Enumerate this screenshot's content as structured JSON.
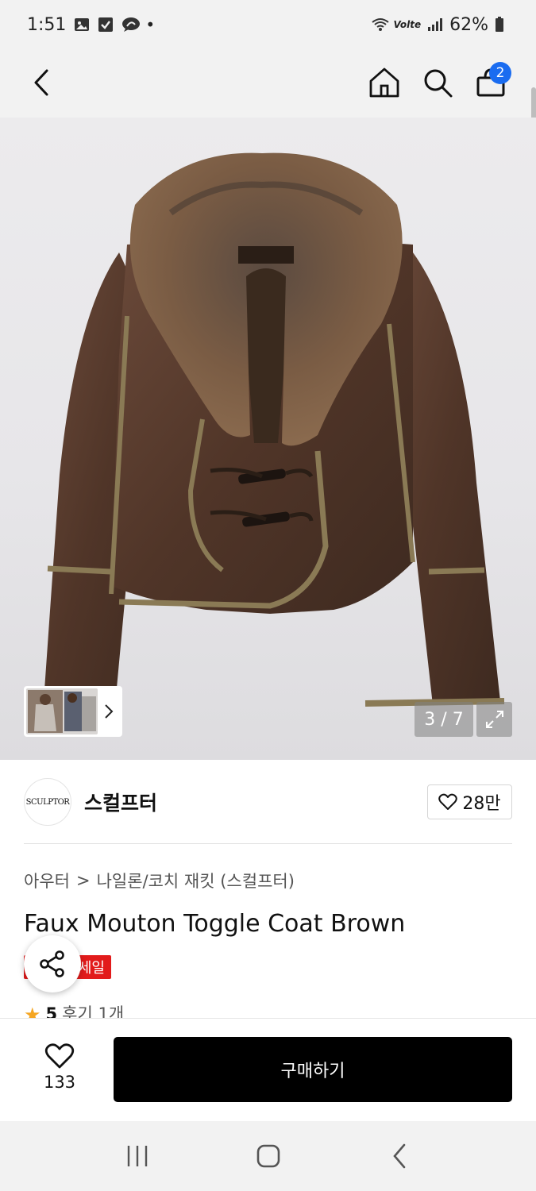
{
  "status_bar": {
    "time": "1:51",
    "battery": "62%",
    "network": "Volte"
  },
  "nav": {
    "cart_count": "2"
  },
  "gallery": {
    "counter": "3 / 7"
  },
  "brand": {
    "logo_text": "SCULPTOR",
    "name": "스컬프터",
    "likes": "28만"
  },
  "breadcrumb": {
    "category": "아우터",
    "separator": ">",
    "subcategory": "나일론/코치 재킷 (스컬프터)"
  },
  "product": {
    "title": "Faux Mouton Toggle Coat Brown",
    "badge": "세일",
    "rating": "5",
    "reviews": "후기 1개"
  },
  "bottom": {
    "wish_count": "133",
    "buy_label": "구매하기"
  },
  "colors": {
    "accent_blue": "#1a6cf0",
    "sale_red": "#e21b1b",
    "star": "#f5a623"
  }
}
